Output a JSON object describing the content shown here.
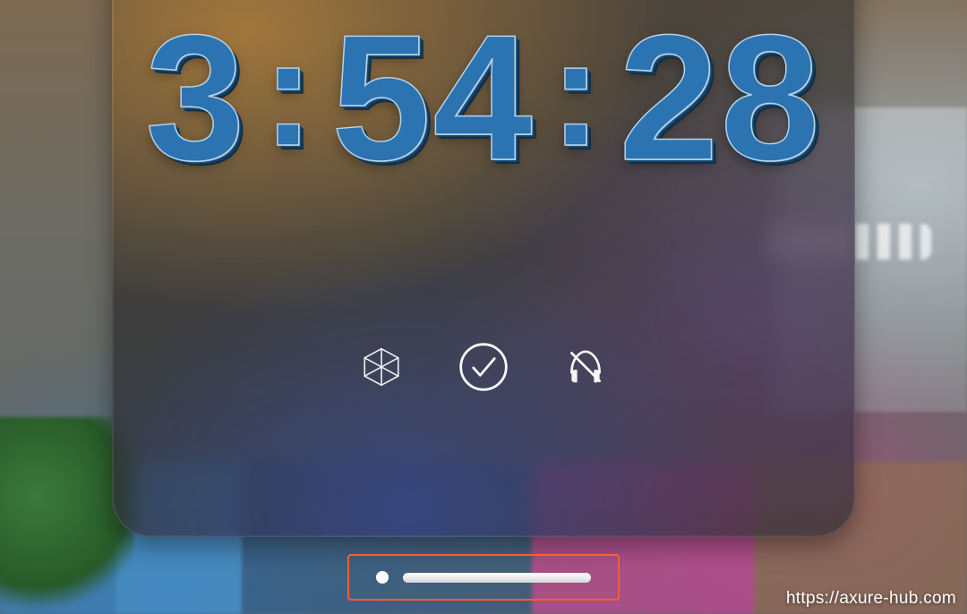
{
  "time": {
    "hours": "3",
    "minutes": "54",
    "seconds": "28",
    "sep": ":"
  },
  "controls": {
    "cube_icon": "cube-wireframe-icon",
    "confirm_icon": "checkmark-circle-icon",
    "headphones_mute_icon": "headphones-off-icon"
  },
  "handle": {
    "highlighted": true
  },
  "watermark": "https://axure-hub.com"
}
